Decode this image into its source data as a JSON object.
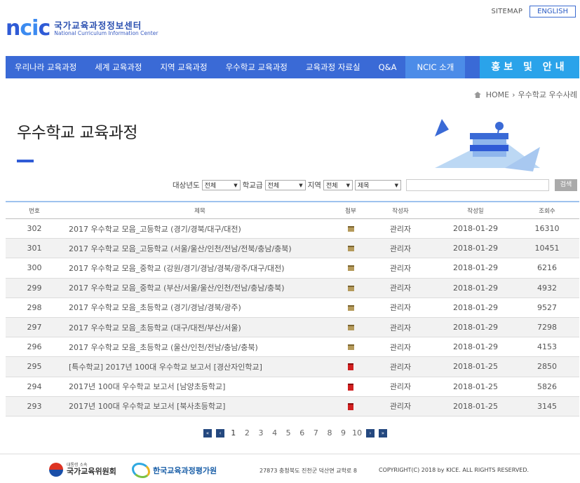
{
  "util": {
    "sitemap": "SITEMAP",
    "english": "ENGLISH"
  },
  "logo": {
    "mark_n": "n",
    "mark_ci": "ci",
    "mark_c": "c",
    "korean": "국가교육과정정보센터",
    "english": "National Curriculum Information Center"
  },
  "nav": {
    "items": [
      "우리나라 교육과정",
      "세계 교육과정",
      "지역 교육과정",
      "우수학교 교육과정",
      "교육과정 자료실",
      "Q&A",
      "NCIC 소개"
    ],
    "promo": "홍보 및 안내"
  },
  "breadcrumb": {
    "home": "HOME",
    "separator": "›",
    "current": "우수학교 우수사례"
  },
  "page": {
    "title": "우수학교 교육과정"
  },
  "search": {
    "year_label": "대상년도",
    "year_value": "전체",
    "level_label": "학교급",
    "level_value": "전체",
    "region_label": "지역",
    "region_value": "전체",
    "field_value": "제목",
    "query": "",
    "button": "검색"
  },
  "table": {
    "headers": {
      "no": "번호",
      "title": "제목",
      "file": "첨부",
      "author": "작성자",
      "date": "작성일",
      "views": "조회수"
    },
    "rows": [
      {
        "no": "302",
        "title": "2017 우수학교 모음_고등학교 (경기/경북/대구/대전)",
        "file": "zip",
        "author": "관리자",
        "date": "2018-01-29",
        "views": "16310"
      },
      {
        "no": "301",
        "title": "2017 우수학교 모음_고등학교 (서울/울산/인천/전남/전북/충남/충북)",
        "file": "zip",
        "author": "관리자",
        "date": "2018-01-29",
        "views": "10451"
      },
      {
        "no": "300",
        "title": "2017 우수학교 모음_중학교 (강원/경기/경남/경북/광주/대구/대전)",
        "file": "zip",
        "author": "관리자",
        "date": "2018-01-29",
        "views": "6216"
      },
      {
        "no": "299",
        "title": "2017 우수학교 모음_중학교 (부산/서울/울산/인천/전남/충남/충북)",
        "file": "zip",
        "author": "관리자",
        "date": "2018-01-29",
        "views": "4932"
      },
      {
        "no": "298",
        "title": "2017 우수학교 모음_초등학교 (경기/경남/경북/광주)",
        "file": "zip",
        "author": "관리자",
        "date": "2018-01-29",
        "views": "9527"
      },
      {
        "no": "297",
        "title": "2017 우수학교 모음_초등학교 (대구/대전/부산/서울)",
        "file": "zip",
        "author": "관리자",
        "date": "2018-01-29",
        "views": "7298"
      },
      {
        "no": "296",
        "title": "2017 우수학교 모음_초등학교 (울산/인천/전남/충남/충북)",
        "file": "zip",
        "author": "관리자",
        "date": "2018-01-29",
        "views": "4153"
      },
      {
        "no": "295",
        "title": "[특수학교] 2017년 100대 우수학교 보고서 [경산자인학교]",
        "file": "pdf",
        "author": "관리자",
        "date": "2018-01-25",
        "views": "2850"
      },
      {
        "no": "294",
        "title": "2017년 100대 우수학교 보고서 [남양초등학교]",
        "file": "pdf",
        "author": "관리자",
        "date": "2018-01-25",
        "views": "5826"
      },
      {
        "no": "293",
        "title": "2017년 100대 우수학교 보고서 [북사초등학교]",
        "file": "pdf",
        "author": "관리자",
        "date": "2018-01-25",
        "views": "3145"
      }
    ]
  },
  "pager": {
    "first": "«",
    "prev": "‹",
    "next": "›",
    "last": "»",
    "pages": [
      "1",
      "2",
      "3",
      "4",
      "5",
      "6",
      "7",
      "8",
      "9",
      "10"
    ],
    "current": "1"
  },
  "footer": {
    "org1_small": "대통령 소속",
    "org1": "국가교육위원회",
    "org2": "한국교육과정평가원",
    "address": "27873 충청북도 진천군 덕산면 교학로 8",
    "copyright": "COPYRIGHT(C) 2018 by KICE. ALL RIGHTS RESERVED."
  },
  "colors": {
    "nav": "#3a6ad6",
    "nav_active": "#4c8ce8",
    "promo": "#2aa3ea",
    "accent": "#2f5bd6"
  }
}
